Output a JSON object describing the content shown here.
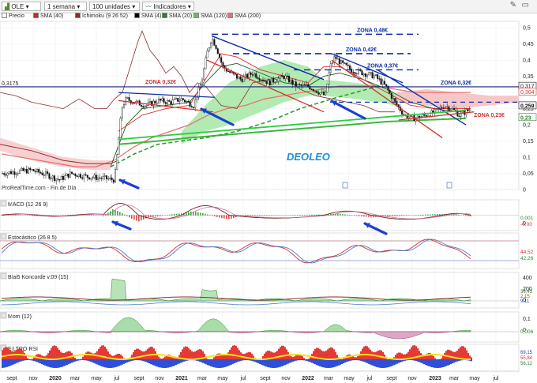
{
  "toolbar": {
    "ticker": "OLE",
    "timeframe": "1 semana",
    "units": "100 unidades",
    "indicators": "Indicadores"
  },
  "legend": [
    {
      "label": "Precio",
      "color": "#ffffff"
    },
    {
      "label": "SMA (40)",
      "color": "#c62828"
    },
    {
      "label": "Ichimoku (9 26 52)",
      "color": "#8e2b2b"
    },
    {
      "label": "SMA (4)",
      "color": "#000000"
    },
    {
      "label": "SMA (20)",
      "color": "#2e7d32"
    },
    {
      "label": "SMA (120)",
      "color": "#66bb6a"
    },
    {
      "label": "SMA (200)",
      "color": "#e57373"
    }
  ],
  "price_scale": {
    "ticks": [
      "0,5",
      "0,45",
      "0,4",
      "0,35",
      "0,3",
      "0,25",
      "0,2",
      "0,15",
      "0,1",
      "0,05",
      "0"
    ],
    "badges": [
      {
        "text": "0,317",
        "color": "#111111"
      },
      {
        "text": "0,304",
        "color": "#d32f2f"
      },
      {
        "text": "0,259",
        "color": "#111111"
      },
      {
        "text": "0,23",
        "color": "#2e7d32"
      }
    ]
  },
  "annotations": {
    "level_left": "0,3175",
    "zones": [
      {
        "text": "ZONA 0,48€",
        "color": "#0d2ea8"
      },
      {
        "text": "ZONA 0,42€",
        "color": "#0d2ea8"
      },
      {
        "text": "ZONA 0,37€",
        "color": "#0d2ea8"
      },
      {
        "text": "ZONA 0,32€",
        "color": "#0d2ea8"
      },
      {
        "text": "ZONA 0,32€",
        "color": "#d32f2f"
      },
      {
        "text": "ZONA 0,23€",
        "color": "#d32f2f"
      }
    ],
    "watermark": "DEOLEO",
    "source": "ProRealTime.com - Fin de Día"
  },
  "panels": [
    {
      "name": "MACD (12 26 9)",
      "badges": [
        "0,001",
        "-0,00"
      ]
    },
    {
      "name": "Estocástico (26 8 5)",
      "badges": [
        "44,52",
        "42,26"
      ]
    },
    {
      "name": "Blai5 Koncorde v.09 (15)",
      "ticks": [
        "400",
        "200",
        "0"
      ],
      "badges": [
        "36,43",
        "2,15",
        "9,11"
      ]
    },
    {
      "name": "Mom (12)",
      "ticks": [
        "0,1",
        "0"
      ],
      "badges": [
        "0,006"
      ]
    },
    {
      "name": "FILTRO RSI",
      "badges": [
        "69,15",
        "55,84",
        "56,12"
      ]
    }
  ],
  "xaxis": [
    "sept",
    "nov",
    "2020",
    "mar",
    "may",
    "jul",
    "sept",
    "nov",
    "2021",
    "mar",
    "may",
    "jul",
    "sept",
    "nov",
    "2022",
    "mar",
    "may",
    "jul",
    "sept",
    "nov",
    "2023",
    "mar",
    "may",
    "jul"
  ],
  "chart_data": {
    "type": "line",
    "series": [
      {
        "name": "Precio",
        "values": [
          0.06,
          0.05,
          0.04,
          0.03,
          0.03,
          0.08,
          0.25,
          0.27,
          0.27,
          0.26,
          0.27,
          0.45,
          0.44,
          0.38,
          0.33,
          0.32,
          0.3,
          0.38,
          0.4,
          0.35,
          0.32,
          0.24,
          0.22,
          0.23,
          0.26,
          0.25
        ]
      },
      {
        "name": "SMA (200)",
        "values": [
          0.11,
          0.1,
          0.09,
          0.08,
          0.07,
          0.07,
          0.09,
          0.13,
          0.16,
          0.18,
          0.2,
          0.23,
          0.25,
          0.26,
          0.28,
          0.29,
          0.3,
          0.31,
          0.32,
          0.32,
          0.32,
          0.31,
          0.3,
          0.3,
          0.3,
          0.3
        ]
      },
      {
        "name": "SMA (120)",
        "values": [
          0.08,
          0.07,
          0.06,
          0.05,
          0.05,
          0.05,
          0.07,
          0.11,
          0.14,
          0.16,
          0.18,
          0.22,
          0.24,
          0.26,
          0.27,
          0.28,
          0.29,
          0.3,
          0.3,
          0.29,
          0.28,
          0.27,
          0.26,
          0.25,
          0.25,
          0.25
        ]
      }
    ],
    "yrange": [
      0,
      0.52
    ]
  }
}
